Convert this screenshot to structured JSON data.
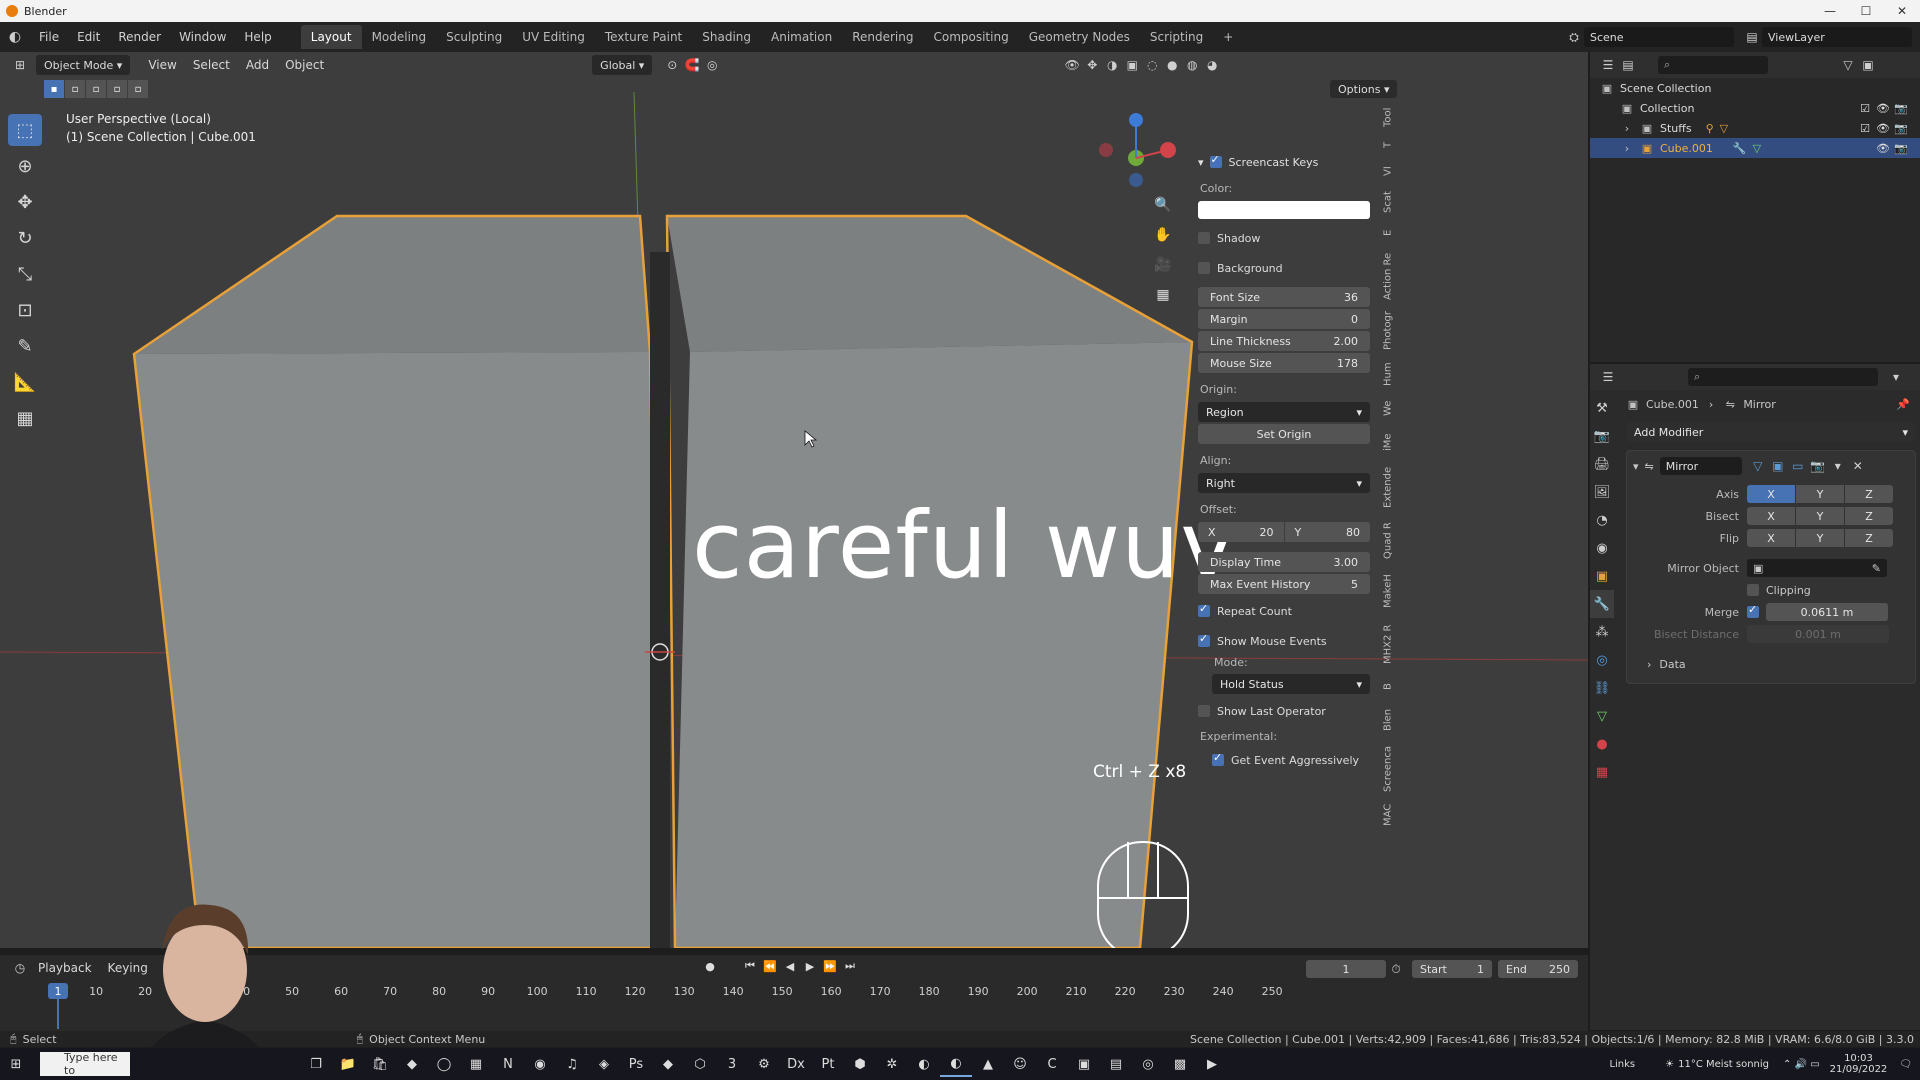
{
  "window": {
    "title": "Blender",
    "controls": [
      "—",
      "☐",
      "✕"
    ]
  },
  "topbar": {
    "menus": [
      "File",
      "Edit",
      "Render",
      "Window",
      "Help"
    ],
    "workspaces": [
      "Layout",
      "Modeling",
      "Sculpting",
      "UV Editing",
      "Texture Paint",
      "Shading",
      "Animation",
      "Rendering",
      "Compositing",
      "Geometry Nodes",
      "Scripting"
    ],
    "active_workspace": "Layout",
    "add_tab": "+",
    "scene": "Scene",
    "view_layer": "ViewLayer"
  },
  "viewport": {
    "mode": "Object Mode",
    "menus": [
      "View",
      "Select",
      "Add",
      "Object"
    ],
    "transform_orientation": "Global",
    "options_label": "Options",
    "perspective_label": "User Perspective (Local)",
    "collection_label": "(1) Scene Collection | Cube.001",
    "caption": "careful wuv",
    "keys_label": "Ctrl + Z x8",
    "gizmo_axes": [
      "Z",
      "Y",
      "X"
    ]
  },
  "screencast_panel": {
    "title": "Screencast Keys",
    "color_label": "Color:",
    "color_value": "#ffffff",
    "shadow_label": "Shadow",
    "background_label": "Background",
    "fields": [
      {
        "label": "Font Size",
        "value": "36"
      },
      {
        "label": "Margin",
        "value": "0"
      },
      {
        "label": "Line Thickness",
        "value": "2.00"
      },
      {
        "label": "Mouse Size",
        "value": "178"
      }
    ],
    "origin_label": "Origin:",
    "origin_value": "Region",
    "set_origin_label": "Set Origin",
    "align_label": "Align:",
    "align_value": "Right",
    "offset_label": "Offset:",
    "offset_x_label": "X",
    "offset_x": "20",
    "offset_y_label": "Y",
    "offset_y": "80",
    "display_time_label": "Display Time",
    "display_time": "3.00",
    "max_history_label": "Max Event History",
    "max_history": "5",
    "repeat_count_label": "Repeat Count",
    "show_mouse_label": "Show Mouse Events",
    "mode_label": "Mode:",
    "mode_value": "Hold Status",
    "show_last_op_label": "Show Last Operator",
    "experimental_label": "Experimental:",
    "get_event_label": "Get Event Aggressively"
  },
  "side_tabs": [
    "Tool",
    "T",
    "VI",
    "Scat",
    "E",
    "Action Re",
    "Photogr",
    "Hum",
    "We",
    "iMe",
    "Extende",
    "Quad R",
    "MakeH",
    "MHX2 R",
    "B",
    "Blen",
    "Screenca",
    "MAC"
  ],
  "timeline": {
    "menus": [
      "Playback",
      "Keying"
    ],
    "current_frame": "1",
    "start_label": "Start",
    "start": "1",
    "end_label": "End",
    "end": "250",
    "ticks": [
      "10",
      "20",
      "40",
      "50",
      "60",
      "70",
      "80",
      "90",
      "100",
      "110",
      "120",
      "130",
      "140",
      "150",
      "160",
      "170",
      "180",
      "190",
      "200",
      "210",
      "220",
      "230",
      "240",
      "250"
    ]
  },
  "outliner": {
    "items": [
      {
        "label": "Scene Collection",
        "level": 0
      },
      {
        "label": "Collection",
        "level": 1
      },
      {
        "label": "Stuffs",
        "level": 1
      },
      {
        "label": "Cube.001",
        "level": 1,
        "selected": true
      }
    ]
  },
  "properties": {
    "breadcrumb_object": "Cube.001",
    "breadcrumb_modifier": "Mirror",
    "add_modifier_label": "Add Modifier",
    "modifier_name": "Mirror",
    "axis_label": "Axis",
    "bisect_label": "Bisect",
    "flip_label": "Flip",
    "axes": [
      "X",
      "Y",
      "Z"
    ],
    "mirror_object_label": "Mirror Object",
    "clipping_label": "Clipping",
    "merge_label": "Merge",
    "merge_value": "0.0611 m",
    "bisect_distance_label": "Bisect Distance",
    "bisect_distance_value": "0.001 m",
    "data_label": "Data"
  },
  "statusbar": {
    "left": "Select",
    "middle": "Object Context Menu",
    "right": "Scene Collection | Cube.001 | Verts:42,909 | Faces:41,686 | Tris:83,524 | Objects:1/6 | Memory: 82.8 MiB | VRAM: 6.6/8.0 GiB | 3.3.0"
  },
  "taskbar": {
    "search_placeholder": "Type here to",
    "weather": "11°C  Meist sonnig",
    "links": "Links",
    "time": "10:03",
    "date": "21/09/2022"
  },
  "colors": {
    "accent": "#4772b3",
    "selection_outline": "#e8a038",
    "viewport_bg": "#3d3d3d"
  }
}
